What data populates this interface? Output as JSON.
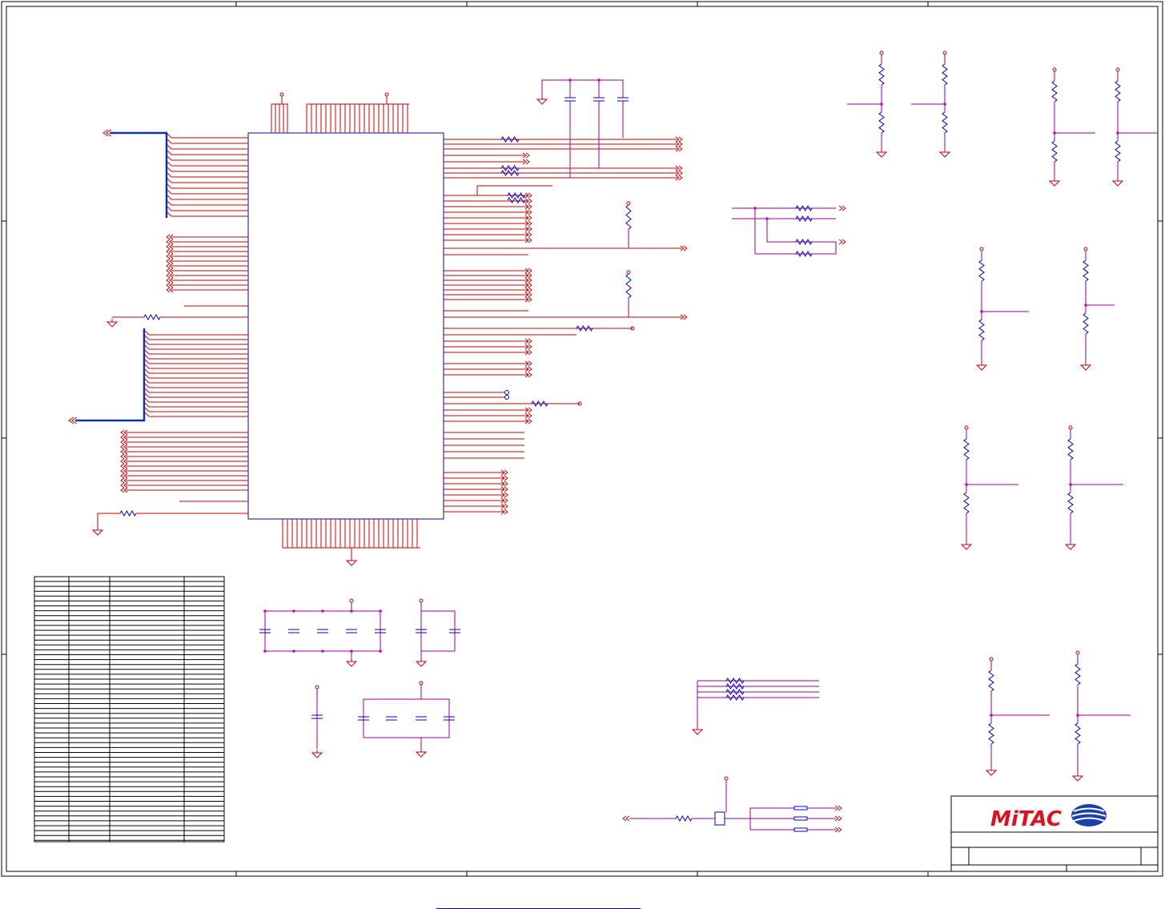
{
  "document": {
    "type": "schematic-sheet",
    "title_block": {
      "logo_text": "MiTAC",
      "colors": {
        "logo_red": "#e0101e",
        "logo_blue": "#1a3fae"
      }
    }
  },
  "colors": {
    "wire": "#cc0000",
    "net": "#990099",
    "bus": "#1133aa",
    "component": "#0000cc",
    "border": "#000000"
  },
  "icons": [
    "ground-symbol",
    "power-pin",
    "resistor-symbol",
    "capacitor-symbol",
    "transistor-symbol",
    "net-arrow"
  ]
}
